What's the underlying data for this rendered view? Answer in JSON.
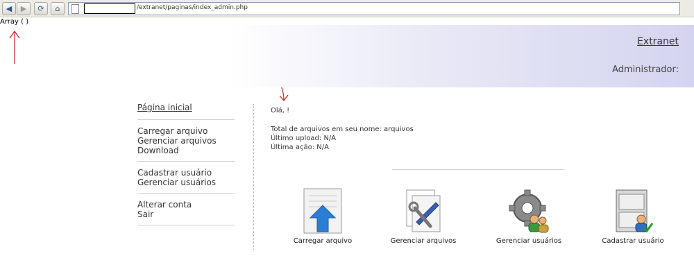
{
  "browser": {
    "back_icon": "back-arrow-icon",
    "forward_icon": "forward-arrow-icon",
    "reload_icon": "reload-icon",
    "home_icon": "home-icon",
    "address_path": "/extranet/paginas/index_admin.php"
  },
  "debug_output": "Array ( )",
  "header": {
    "brand_link": "Extranet",
    "role": "Administrador:"
  },
  "sidebar": {
    "home": "Página inicial",
    "files": [
      "Carregar arquivo",
      "Gerenciar arquivos",
      "Download"
    ],
    "users": [
      "Cadastrar usuário",
      "Gerenciar usuários"
    ],
    "account": [
      "Alterar conta",
      "Sair"
    ]
  },
  "main": {
    "greeting": "Olá, !",
    "total_files": "Total de arquivos em seu nome: arquivos",
    "last_upload": "Último upload: N/A",
    "last_action": "Última ação: N/A"
  },
  "shortcuts": [
    {
      "label": "Carregar arquivo",
      "icon": "upload-document-icon"
    },
    {
      "label": "Gerenciar arquivos",
      "icon": "manage-files-tools-icon"
    },
    {
      "label": "Gerenciar usuários",
      "icon": "gear-users-icon"
    },
    {
      "label": "Cadastrar usuário",
      "icon": "register-user-cabinet-icon"
    }
  ],
  "colors": {
    "annotation_red": "#cc2222",
    "header_gradient_end": "#d4d4f0"
  }
}
